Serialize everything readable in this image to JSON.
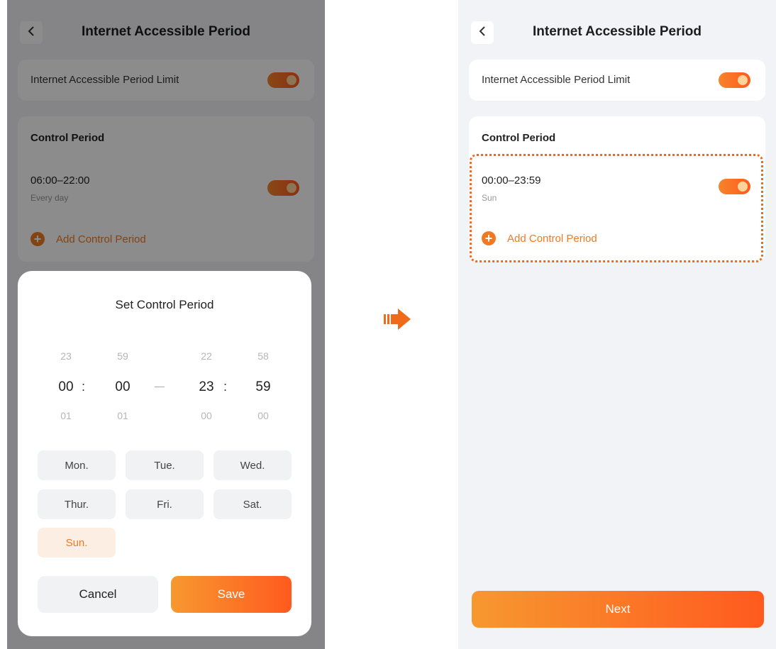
{
  "left_screen": {
    "back_icon": "chevron-left-icon",
    "title": "Internet Accessible Period",
    "limit_label": "Internet Accessible Period Limit",
    "limit_enabled": true,
    "period_header": "Control Period",
    "period_time": "06:00–22:00",
    "period_days": "Every day",
    "period_enabled": true,
    "add_period_label": "Add Control Period",
    "dialog": {
      "title": "Set Control Period",
      "start_hour": {
        "prev": "23",
        "selected": "00",
        "next": "01"
      },
      "start_minute": {
        "prev": "59",
        "selected": "00",
        "next": "01"
      },
      "end_hour": {
        "prev": "22",
        "selected": "23",
        "next": "00"
      },
      "end_minute": {
        "prev": "58",
        "selected": "59",
        "next": "00"
      },
      "time_separator": ":",
      "days": [
        {
          "label": "Mon.",
          "selected": false
        },
        {
          "label": "Tue.",
          "selected": false
        },
        {
          "label": "Wed.",
          "selected": false
        },
        {
          "label": "Thur.",
          "selected": false
        },
        {
          "label": "Fri.",
          "selected": false
        },
        {
          "label": "Sat.",
          "selected": false
        },
        {
          "label": "Sun.",
          "selected": true
        }
      ],
      "cancel_label": "Cancel",
      "save_label": "Save"
    }
  },
  "right_screen": {
    "back_icon": "chevron-left-icon",
    "title": "Internet Accessible Period",
    "limit_label": "Internet Accessible Period Limit",
    "limit_enabled": true,
    "period_header": "Control Period",
    "period_time": "00:00–23:59",
    "period_days": "Sun",
    "period_enabled": true,
    "add_period_label": "Add Control Period",
    "next_label": "Next"
  },
  "colors": {
    "accent": "#f07a23",
    "accent_gradient_end": "#ff5a1f",
    "background": "#f2f3f7",
    "highlight_border": "#f06a1c"
  }
}
